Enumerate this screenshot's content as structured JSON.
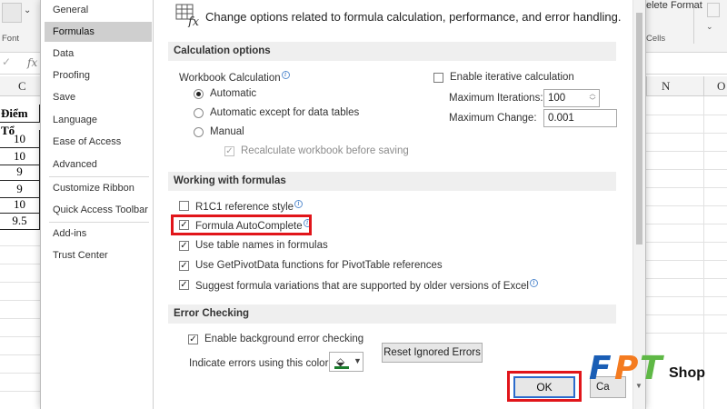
{
  "excel": {
    "ribbon_font_group": "Font",
    "ribbon_delete": "elete",
    "ribbon_format": "Format",
    "ribbon_cells_group": "Cells",
    "fx": "fx",
    "columns": [
      "C",
      "N",
      "O"
    ],
    "cells": [
      "Điểm Tổ",
      "10",
      "10",
      "9",
      "9",
      "10",
      "9.5"
    ]
  },
  "dialog": {
    "nav": [
      "General",
      "Formulas",
      "Data",
      "Proofing",
      "Save",
      "Language",
      "Ease of Access",
      "Advanced",
      "Customize Ribbon",
      "Quick Access Toolbar",
      "Add-ins",
      "Trust Center"
    ],
    "selected_nav": "Formulas",
    "header_text": "Change options related to formula calculation, performance, and error handling.",
    "calc": {
      "title": "Calculation options",
      "workbook_calc_label": "Workbook Calculation",
      "automatic": "Automatic",
      "automatic_except": "Automatic except for data tables",
      "manual": "Manual",
      "recalc_before_saving": "Recalculate workbook before saving",
      "enable_iterative": "Enable iterative calculation",
      "max_iterations_label": "Maximum Iterations:",
      "max_iterations_value": "100",
      "max_change_label": "Maximum Change:",
      "max_change_value": "0.001"
    },
    "formulas": {
      "title": "Working with formulas",
      "r1c1": "R1C1 reference style",
      "autocomplete": "Formula AutoComplete",
      "table_names": "Use table names in formulas",
      "getpivotdata": "Use GetPivotData functions for PivotTable references",
      "suggest": "Suggest formula variations that are supported by older versions of Excel"
    },
    "errors": {
      "title": "Error Checking",
      "enable_background": "Enable background error checking",
      "indicate_color": "Indicate errors using this color:",
      "reset_button": "Reset Ignored Errors"
    },
    "ok": "OK",
    "cancel_partial": "Ca"
  },
  "logo": {
    "letters": [
      "F",
      "P",
      "T"
    ],
    "shop": "Shop"
  },
  "colors": {
    "highlight_red": "#e1151a",
    "ok_border": "#2b6bcc",
    "logo_blue": "#1a5eb5",
    "logo_orange": "#f47b20",
    "logo_green": "#5fb846",
    "error_color": "#1b7c2e"
  }
}
